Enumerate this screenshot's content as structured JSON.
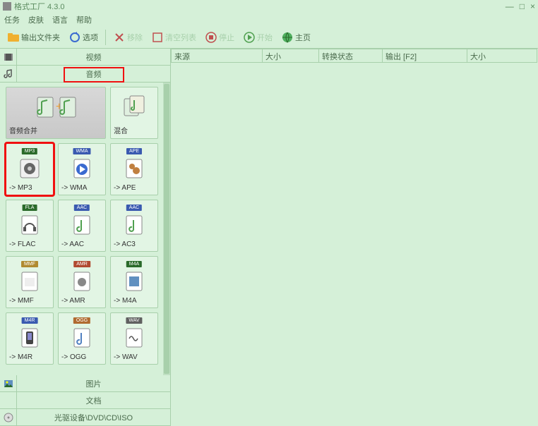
{
  "app": {
    "title": "格式工厂 4.3.0"
  },
  "winbtns": {
    "min": "—",
    "max": "□",
    "close": "×"
  },
  "menu": {
    "task": "任务",
    "skin": "皮肤",
    "lang": "语言",
    "help": "帮助"
  },
  "toolbar": {
    "output": "输出文件夹",
    "options": "选项",
    "remove": "移除",
    "clear": "清空列表",
    "stop": "停止",
    "start": "开始",
    "home": "主页"
  },
  "leftcats": {
    "video": "视频",
    "audio": "音频",
    "picture": "图片",
    "document": "文档",
    "drive": "光驱设备\\DVD\\CD\\ISO"
  },
  "formats": {
    "audio_merge": "音频合并",
    "mix": "混合",
    "mp3": "-> MP3",
    "wma": "-> WMA",
    "ape": "-> APE",
    "flac": "-> FLAC",
    "aac": "-> AAC",
    "ac3": "-> AC3",
    "mmf": "-> MMF",
    "amr": "-> AMR",
    "m4a": "-> M4A",
    "m4r": "-> M4R",
    "ogg": "-> OGG",
    "wav": "-> WAV"
  },
  "badges": {
    "mp3": "MP3",
    "wma": "WMA",
    "ape": "APE",
    "fla": "FLA",
    "aac": "AAC",
    "mmf": "MMF",
    "amr": "AMR",
    "m4a": "M4A",
    "m4r": "M4R",
    "ogg": "OGG",
    "wav": "WAV"
  },
  "badgecolors": {
    "mp3": "#2a6a2a",
    "wma": "#3a5ab0",
    "ape": "#3a5ab0",
    "fla": "#2a6a2a",
    "aac": "#3a5ab0",
    "mmf": "#b08a30",
    "amr": "#b04a30",
    "m4a": "#2a6a2a",
    "m4r": "#3a5ab0",
    "ogg": "#b06a30",
    "wav": "#606060"
  },
  "columns": {
    "source": "来源",
    "size": "大小",
    "status": "转换状态",
    "output": "输出 [F2]",
    "outsize": "大小"
  },
  "colwidths": {
    "source": 130,
    "size": 80,
    "status": 90,
    "output": 120,
    "outsize": 99
  }
}
